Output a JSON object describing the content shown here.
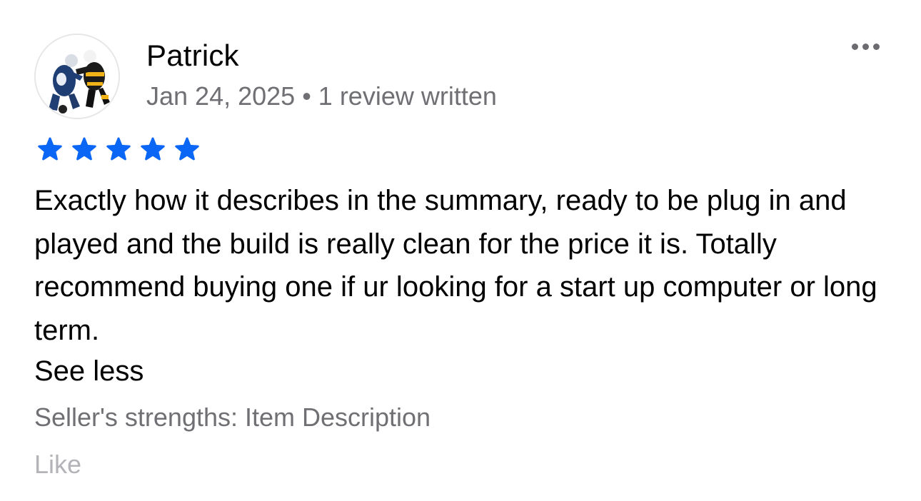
{
  "review": {
    "reviewer_name": "Patrick",
    "date": "Jan 24, 2025",
    "separator": "•",
    "review_count": "1 review written",
    "rating": 5,
    "rating_max": 5,
    "body": "Exactly how it describes in the summary, ready to be plug in and played and the build is really clean for the price it is. Totally recommend buying one if ur looking for a start up computer or long term.",
    "see_less_label": "See less",
    "seller_strengths": "Seller's strengths: Item Description",
    "like_label": "Like"
  },
  "icons": {
    "more": "more-horizontal-icon",
    "star": "star-icon",
    "avatar": "hockey-players-avatar"
  },
  "colors": {
    "star": "#0a66f5",
    "secondary_text": "#6f6f74",
    "muted_text": "#b3b3b8",
    "primary_text": "#000000"
  }
}
